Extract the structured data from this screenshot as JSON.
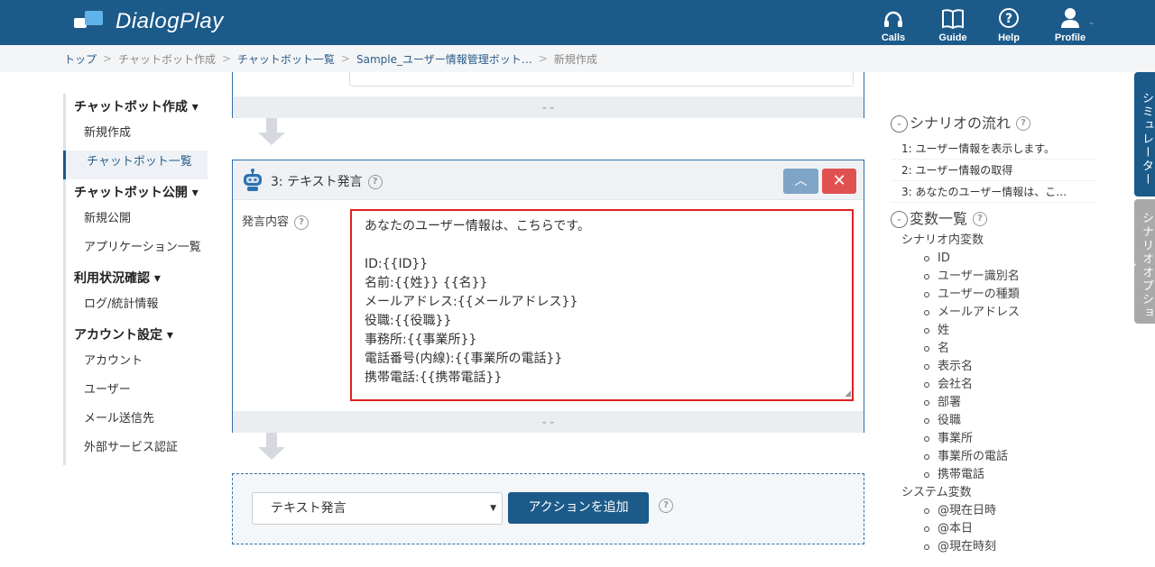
{
  "header": {
    "app_name": "DialogPlay",
    "nav": [
      {
        "label": "Calls",
        "icon": "headset-icon"
      },
      {
        "label": "Guide",
        "icon": "book-icon"
      },
      {
        "label": "Help",
        "icon": "help-icon"
      },
      {
        "label": "Profile",
        "icon": "user-icon"
      }
    ]
  },
  "breadcrumb": [
    "トップ",
    "チャットボット作成",
    "チャットボット一覧",
    "Sample_ユーザー情報管理ボット…",
    "新規作成"
  ],
  "sidebar": {
    "sections": [
      {
        "title": "チャットボット作成",
        "items": [
          "新規作成",
          "チャットボット一覧"
        ]
      },
      {
        "title": "チャットボット公開",
        "items": [
          "新規公開",
          "アプリケーション一覧"
        ]
      },
      {
        "title": "利用状況確認",
        "items": [
          "ログ/統計情報"
        ]
      },
      {
        "title": "アカウント設定",
        "items": [
          "アカウント",
          "ユーザー",
          "メール送信先",
          "外部サービス認証"
        ]
      }
    ],
    "active_item": "チャットボット一覧"
  },
  "action_block": {
    "title": "3: テキスト発言",
    "field_label": "発言内容",
    "text_content": "あなたのユーザー情報は、こちらです。\n\nID:{{ID}}\n名前:{{姓}} {{名}}\nメールアドレス:{{メールアドレス}}\n役職:{{役職}}\n事務所:{{事業所}}\n電話番号(内線):{{事業所の電話}}\n携帯電話:{{携帯電話}}"
  },
  "add_action": {
    "select_value": "テキスト発言",
    "button_label": "アクションを追加"
  },
  "right_panel": {
    "flow_title": "シナリオの流れ",
    "flow_items": [
      {
        "label": "1: ユーザー情報を表示します。",
        "icon": "speech-bubble-icon"
      },
      {
        "label": "2: ユーザー情報の取得",
        "icon": "link-icon"
      },
      {
        "label": "3: あなたのユーザー情報は、こ…",
        "icon": "speech-bubble-icon"
      }
    ],
    "vars_title": "変数一覧",
    "scenario_vars_label": "シナリオ内変数",
    "scenario_vars": [
      "ID",
      "ユーザー識別名",
      "ユーザーの種類",
      "メールアドレス",
      "姓",
      "名",
      "表示名",
      "会社名",
      "部署",
      "役職",
      "事業所",
      "事業所の電話",
      "携帯電話"
    ],
    "system_vars_label": "システム変数",
    "system_vars": [
      "@現在日時",
      "@本日",
      "@現在時刻"
    ]
  },
  "side_tabs": {
    "simulator": "シミュレーター",
    "scenario_options": "シナリオオプション"
  },
  "colors": {
    "header_bg": "#1c5a8a",
    "accent": "#1c5a8a",
    "highlight_border": "#e02020",
    "close_button": "#e05050"
  }
}
